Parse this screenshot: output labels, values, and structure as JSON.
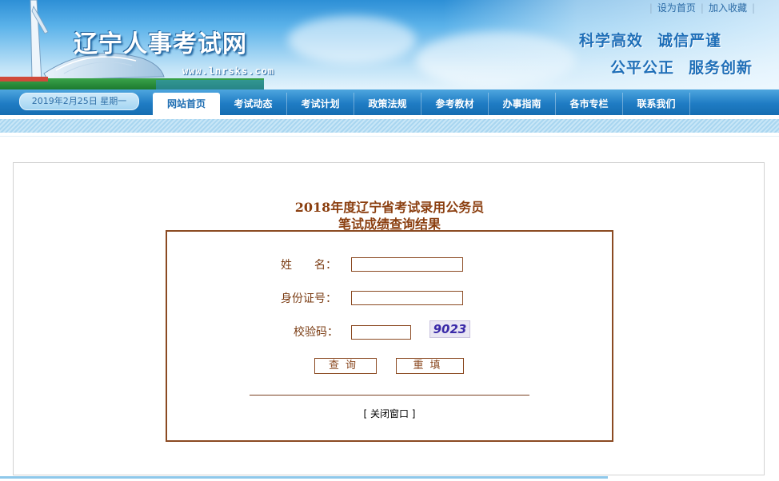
{
  "header": {
    "site_title": "辽宁人事考试网",
    "site_url": "www.lnrsks.com",
    "slogans": [
      "科学高效",
      "诚信严谨",
      "公平公正",
      "服务创新"
    ],
    "top_links": [
      "设为首页",
      "加入收藏"
    ]
  },
  "nav": {
    "date": "2019年2月25日 星期一",
    "items": [
      "网站首页",
      "考试动态",
      "考试计划",
      "政策法规",
      "参考教材",
      "办事指南",
      "各市专栏",
      "联系我们"
    ],
    "active_index": 0
  },
  "query": {
    "title_line1": "2018年度辽宁省考试录用公务员",
    "title_line2": "笔试成绩查询结果",
    "name_label": "姓　　名：",
    "id_label": "身份证号：",
    "code_label": "校验码：",
    "name_value": "",
    "id_value": "",
    "code_value": "",
    "captcha_text": "9023",
    "submit_label": "查询",
    "reset_label": "重填",
    "close_label": "[ 关闭窗口 ]"
  },
  "colors": {
    "accent_brown": "#8b4a22",
    "nav_blue": "#1f7cc4",
    "heading_brown": "#8b3f10"
  }
}
